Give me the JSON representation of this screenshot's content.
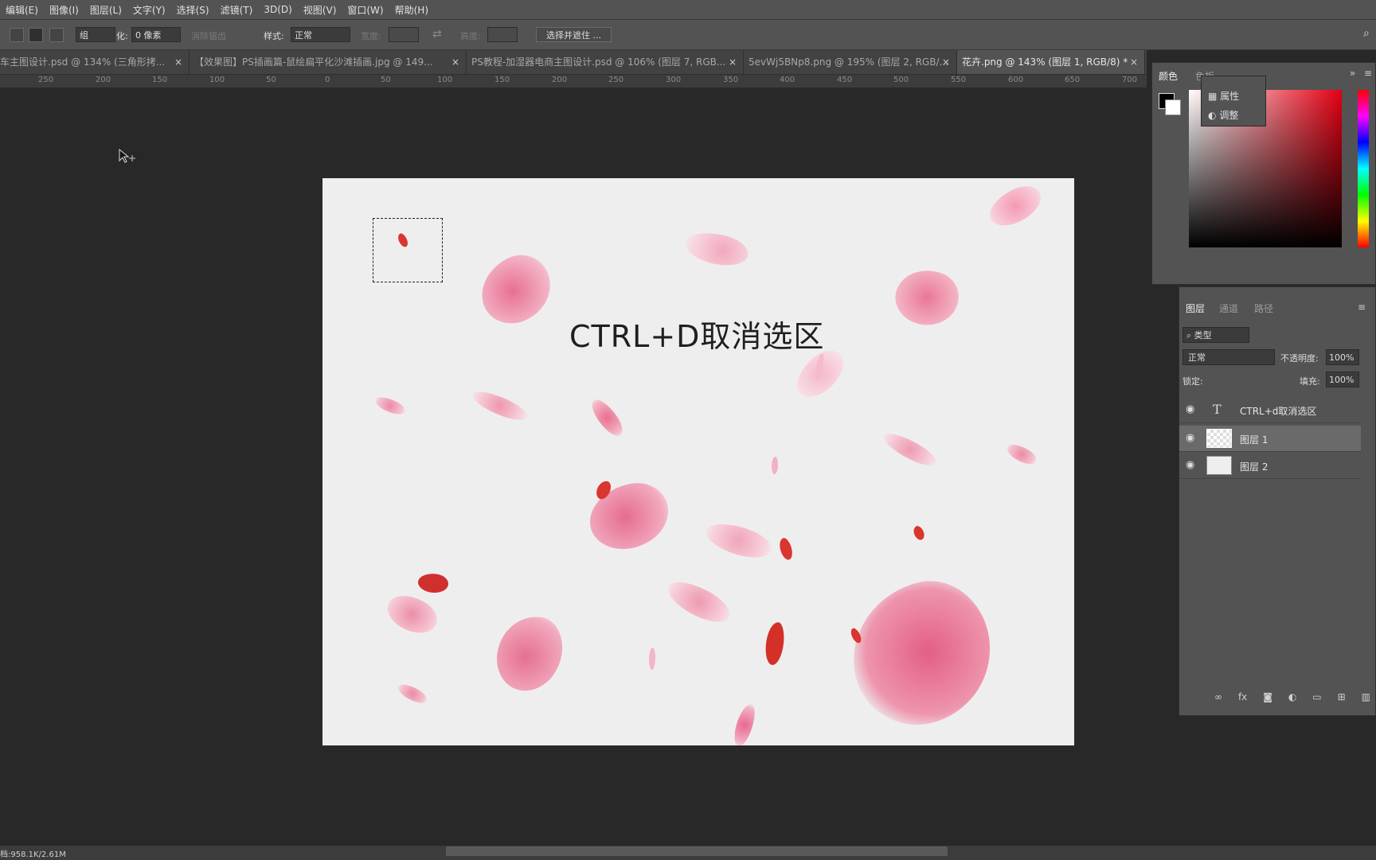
{
  "menu": [
    "编辑(E)",
    "图像(I)",
    "图层(L)",
    "文字(Y)",
    "选择(S)",
    "滤镜(T)",
    "3D(D)",
    "视图(V)",
    "窗口(W)",
    "帮助(H)"
  ],
  "options": {
    "mode_value": "组",
    "feather_label": "化:",
    "feather_value": "0 像素",
    "antialias_label": "消除锯齿",
    "style_label": "样式:",
    "style_value": "正常",
    "width_label": "宽度:",
    "height_label": "高度:",
    "select_mask_button": "选择并遮住 ..."
  },
  "tabs": [
    {
      "label": "车主图设计.psd @ 134% (三角形拷...",
      "active": false
    },
    {
      "label": "【效果图】PS插画篇-鼠绘扁平化沙滩插画.jpg @ 149...",
      "active": false
    },
    {
      "label": "PS教程-加湿器电商主图设计.psd @ 106% (图层 7, RGB...",
      "active": false
    },
    {
      "label": "5evWj5BNp8.png @ 195% (图层 2, RGB/...",
      "active": false
    },
    {
      "label": "花卉.png @ 143% (图层 1, RGB/8) *",
      "active": true
    }
  ],
  "ruler_ticks": [
    "250",
    "200",
    "150",
    "100",
    "50",
    "0",
    "50",
    "100",
    "150",
    "200",
    "250",
    "300",
    "350",
    "400",
    "450",
    "500",
    "550",
    "600",
    "650",
    "700"
  ],
  "canvas": {
    "text": "CTRL+D取消选区"
  },
  "color_panel": {
    "tabs": [
      "颜色",
      "色板"
    ],
    "flyout_items": [
      "属性",
      "调整"
    ]
  },
  "layers_panel": {
    "tabs": [
      "图层",
      "通道",
      "路径"
    ],
    "filter_value": "类型",
    "blend_value": "正常",
    "opacity_label": "不透明度:",
    "opacity_value": "100%",
    "lock_label": "锁定:",
    "fill_label": "填充:",
    "fill_value": "100%",
    "layers": [
      {
        "name": "CTRL+d取消选区",
        "type": "text",
        "selected": false
      },
      {
        "name": "图层 1",
        "type": "pixel",
        "selected": true
      },
      {
        "name": "图层 2",
        "type": "pixel",
        "selected": false
      }
    ]
  },
  "status": {
    "doc_info": "档:958.1K/2.61M"
  },
  "colors": {
    "petal_pink": "#e8789a",
    "petal_red": "#d8362f",
    "canvas_bg": "#efeeef",
    "ui_gray": "#535353"
  }
}
